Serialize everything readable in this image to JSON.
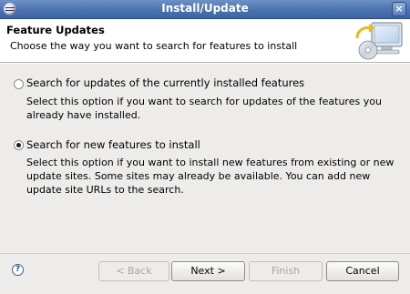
{
  "window": {
    "title": "Install/Update",
    "close_glyph": "×"
  },
  "header": {
    "title": "Feature Updates",
    "description": "Choose the way you want to search for features to install",
    "graphic_icon": "computer-update-icon"
  },
  "options": [
    {
      "label": "Search for updates of the currently installed features",
      "description": "Select this option if you want to search for updates of the features you already have installed.",
      "selected": false
    },
    {
      "label": "Search for new features to install",
      "description": "Select this option if you want to install new features from existing or new update sites. Some sites may already be available. You can add new update site URLs to the search.",
      "selected": true
    }
  ],
  "buttons": {
    "help_glyph": "?",
    "back": "< Back",
    "next": "Next >",
    "finish": "Finish",
    "cancel": "Cancel"
  }
}
